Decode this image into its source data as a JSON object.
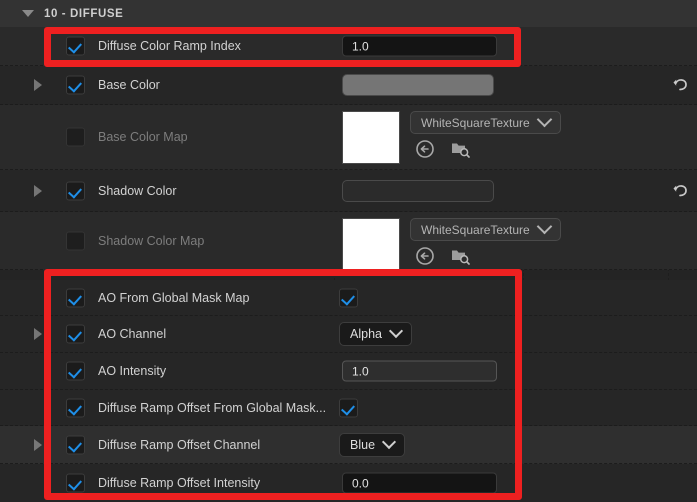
{
  "panel": {
    "category": {
      "label": "10 - DIFFUSE",
      "expanded": true,
      "caret_icon": "caret-down-icon"
    },
    "accent_color": "#ee2020",
    "checkbox_color": "#1f8fe8"
  },
  "rows": [
    {
      "label": "Diffuse Color Ramp Index",
      "checked": true,
      "has_expander": false,
      "dim": false,
      "value_type": "number",
      "value": "1.0",
      "hovered": false,
      "revert": false
    },
    {
      "label": "Base Color",
      "checked": true,
      "has_expander": true,
      "dim": false,
      "value_type": "color",
      "value": "#757575",
      "revert": true
    },
    {
      "label": "Base Color Map",
      "checked": false,
      "has_expander": false,
      "dim": true,
      "value_type": "texture",
      "asset_name": "WhiteSquareTexture",
      "thumbnail": "#ffffff",
      "buttons": [
        "browse-to-asset-icon",
        "find-in-content-browser-icon"
      ],
      "revert": false
    },
    {
      "label": "Shadow Color",
      "checked": true,
      "has_expander": true,
      "dim": false,
      "value_type": "color",
      "value": "#2b2b2b",
      "revert": true
    },
    {
      "label": "Shadow Color Map",
      "checked": false,
      "has_expander": false,
      "dim": true,
      "value_type": "texture",
      "asset_name": "WhiteSquareTexture",
      "thumbnail": "#ffffff",
      "buttons": [
        "browse-to-asset-icon",
        "find-in-content-browser-icon"
      ],
      "revert": false
    },
    {
      "label": "AO From Global Mask Map",
      "checked": true,
      "has_expander": false,
      "dim": false,
      "value_type": "checkbox",
      "value": true,
      "revert": false
    },
    {
      "label": "AO Channel",
      "checked": true,
      "has_expander": true,
      "dim": false,
      "value_type": "dropdown",
      "value": "Alpha",
      "revert": false
    },
    {
      "label": "AO Intensity",
      "checked": true,
      "has_expander": false,
      "dim": false,
      "value_type": "number",
      "value": "1.0",
      "hovered": true,
      "revert": false
    },
    {
      "label": "Diffuse Ramp Offset From Global Mask...",
      "checked": true,
      "has_expander": false,
      "dim": false,
      "value_type": "checkbox",
      "value": true,
      "revert": false
    },
    {
      "label": "Diffuse Ramp Offset Channel",
      "checked": true,
      "has_expander": true,
      "dim": false,
      "value_type": "dropdown",
      "value": "Blue",
      "revert": false
    },
    {
      "label": "Diffuse Ramp Offset Intensity",
      "checked": true,
      "has_expander": false,
      "dim": false,
      "value_type": "number",
      "value": "0.0",
      "hovered": false,
      "revert": false
    }
  ],
  "annotations": [
    {
      "name": "highlight-diffuse-color-ramp-index",
      "target_row": 0
    },
    {
      "name": "highlight-ao-and-ramp-offset-group",
      "target_rows": [
        5,
        6,
        7,
        8,
        9,
        10
      ]
    }
  ]
}
